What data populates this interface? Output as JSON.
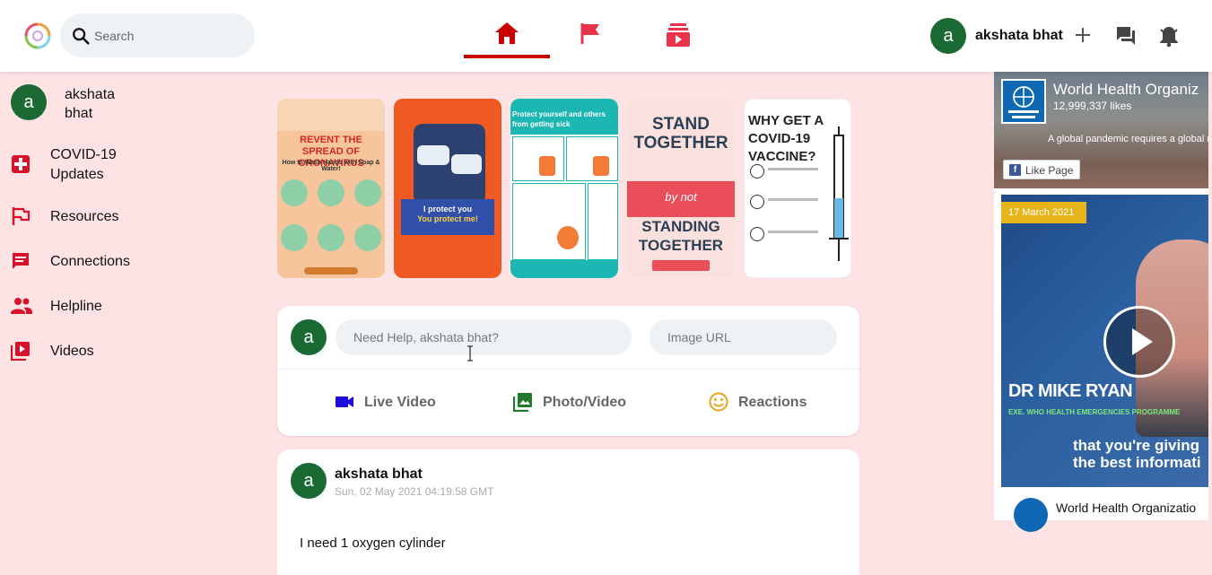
{
  "header": {
    "search_placeholder": "Search",
    "user_name": "akshata bhat",
    "avatar_letter": "a"
  },
  "sidebar": {
    "user_name": "akshata bhat",
    "avatar_letter": "a",
    "items": [
      {
        "label": "COVID-19 Updates",
        "icon": "medical-cross-icon"
      },
      {
        "label": "Resources",
        "icon": "flag-icon"
      },
      {
        "label": "Connections",
        "icon": "chat-icon"
      },
      {
        "label": "Helpline",
        "icon": "people-icon"
      },
      {
        "label": "Videos",
        "icon": "video-library-icon"
      }
    ]
  },
  "stories": [
    {
      "text": "REVENT THE SPREAD OF ORONAVIRUS",
      "sub": "How to Wash Hands with Soap & Water!"
    },
    {
      "text": "I protect you",
      "sub": "You protect me!"
    },
    {
      "text": "Protect yourself and others from getting sick",
      "sub": ""
    },
    {
      "text": "STAND TOGETHER",
      "sub": "STANDING TOGETHER",
      "mid": "by not"
    },
    {
      "text": "WHY GET A COVID-19 VACCINE?",
      "sub": ""
    }
  ],
  "composer": {
    "avatar_letter": "a",
    "help_placeholder": "Need Help, akshata bhat?",
    "image_placeholder": "Image URL",
    "options": [
      {
        "label": "Live Video",
        "icon": "videocam-icon",
        "color": "#1c0ed6"
      },
      {
        "label": "Photo/Video",
        "icon": "photo-library-icon",
        "color": "#1f7a2a"
      },
      {
        "label": "Reactions",
        "icon": "emoji-icon",
        "color": "#e8a317"
      }
    ]
  },
  "post": {
    "avatar_letter": "a",
    "author": "akshata bhat",
    "timestamp": "Sun, 02 May 2021 04:19:58 GMT",
    "body": "I need 1 oxygen cylinder"
  },
  "fb_page": {
    "title": "World Health Organiz",
    "likes": "12,999,337 likes",
    "tagline": "A global pandemic requires a global r",
    "like_button": "Like Page"
  },
  "video": {
    "date": "17 March 2021",
    "speaker": "DR MIKE RYAN",
    "role": "EXE. WHO HEALTH EMERGENCIES PROGRAMME",
    "caption_line1": "that you're giving",
    "caption_line2": "the best informati",
    "footer_title": "World Health Organizatio"
  },
  "colors": {
    "accent": "#c80000",
    "avatar_green": "#1b6a34",
    "page_bg": "#fde3e4"
  }
}
